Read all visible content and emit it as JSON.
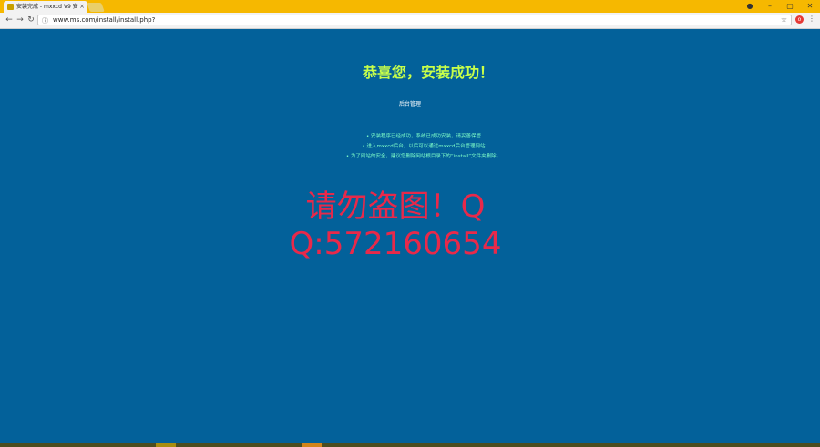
{
  "browser": {
    "tab_title": "安装完成 - mxxcd V9 安",
    "url": "www.ms.com/install/install.php?",
    "colors": {
      "titlebar": "#f6b800",
      "page_bg": "#03619a"
    },
    "icons": [
      "back-icon",
      "forward-icon",
      "reload-icon",
      "info-icon",
      "star-icon",
      "menu-icon"
    ]
  },
  "page": {
    "heading": "恭喜您，安装成功！",
    "subheading": "后台管理",
    "notes": [
      "• 安装程序已经成功，系统已成功安装，请妥善保管",
      "• 进入mxxcd后台，以后可以通过mxxcd后台管理网站",
      "• 为了网站的安全，建议您删除网站根目录下的“install”文件夹删除。"
    ]
  },
  "watermark": {
    "line1": "请勿盗图！Q",
    "line2": "Q:572160654",
    "color": "#e8294a"
  }
}
